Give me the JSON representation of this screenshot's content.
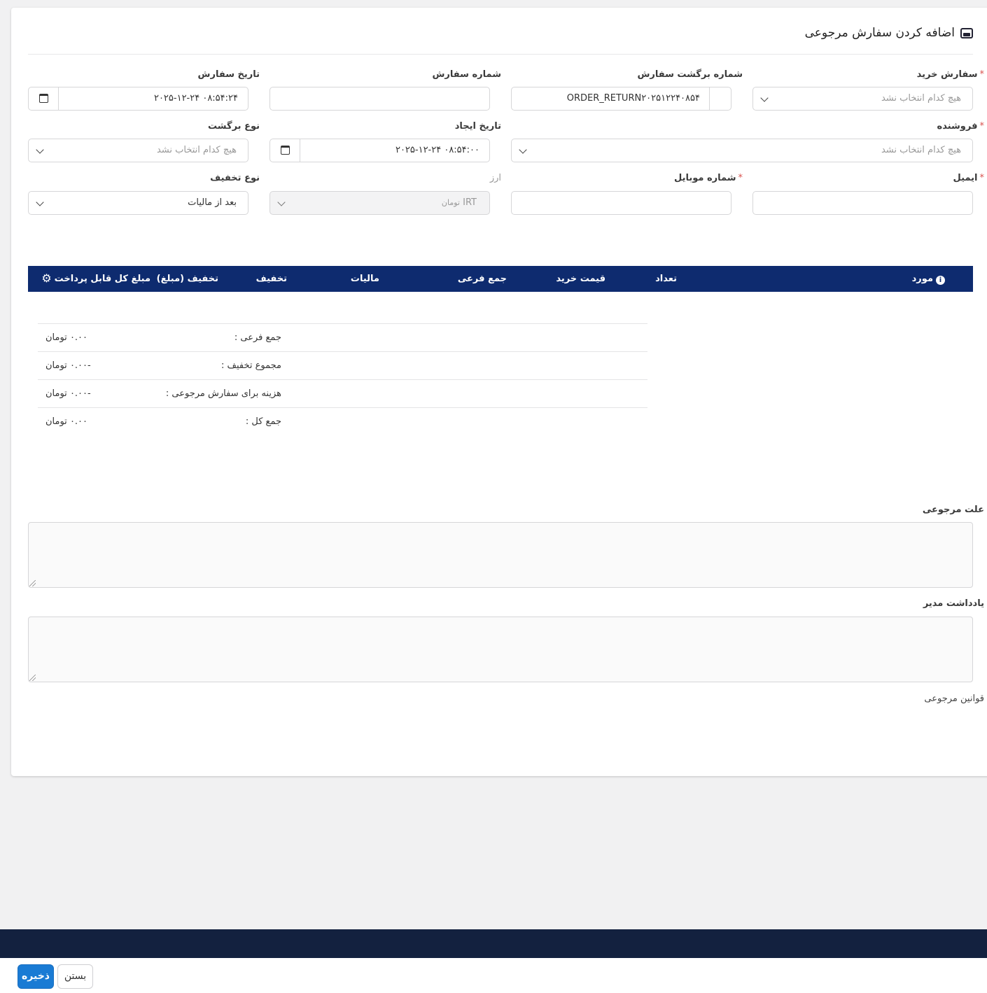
{
  "page": {
    "title": "اضافه کردن سفارش مرجوعی"
  },
  "form": {
    "purchase_order": {
      "label": "سفارش خرید",
      "required": "*",
      "placeholder": "هیچ کدام انتخاب نشد"
    },
    "return_number": {
      "label": "شماره برگشت سفارش",
      "value": "ORDER_RETURN۲۰۲۵۱۲۲۴۰۸۵۴"
    },
    "order_number": {
      "label": "شماره سفارش",
      "value": ""
    },
    "order_date": {
      "label": "تاریخ سفارش",
      "value": "۲۰۲۵-۱۲-۲۴ ۰۸:۵۴:۲۴"
    },
    "vendor": {
      "label": "فروشنده",
      "required": "*",
      "placeholder": "هیچ کدام انتخاب نشد"
    },
    "created_date": {
      "label": "تاریخ ایجاد",
      "value": "۲۰۲۵-۱۲-۲۴ ۰۸:۵۴:۰۰"
    },
    "return_type": {
      "label": "نوع برگشت",
      "placeholder": "هیچ کدام انتخاب نشد"
    },
    "email": {
      "label": "ایمیل",
      "required": "*",
      "value": ""
    },
    "mobile": {
      "label": "شماره موبایل",
      "required": "*",
      "value": ""
    },
    "currency": {
      "label": "ارز",
      "value": "IRT",
      "sub": "تومان"
    },
    "discount_type": {
      "label": "نوع تخفیف",
      "value": "بعد از مالیات"
    }
  },
  "table": {
    "columns": {
      "item": "مورد",
      "qty": "تعداد",
      "price": "قیمت خرید",
      "subtotal": "جمع فرعی",
      "tax": "مالیات",
      "discount": "تخفیف",
      "discount_amount": "تخفیف (مبلغ)",
      "total": "مبلغ کل قابل پرداخت"
    },
    "info_icon": "i",
    "settings_icon": "⚙"
  },
  "totals": [
    {
      "label": "جمع فرعی :",
      "value": "۰.۰۰ تومان"
    },
    {
      "label": "مجموع تخفیف :",
      "value": "-۰.۰۰ تومان"
    },
    {
      "label": "هزینه برای سفارش مرجوعی :",
      "value": "-۰.۰۰ تومان"
    },
    {
      "label": "جمع کل :",
      "value": "۰.۰۰ تومان"
    }
  ],
  "return_reason": {
    "label": "علت مرجوعی",
    "value": ""
  },
  "admin_note": {
    "label": "یادداشت مدیر",
    "value": ""
  },
  "return_policy": {
    "label": "قوانین مرجوعی"
  },
  "footer": {
    "save": "ذخیره",
    "close": "بستن"
  },
  "colors": {
    "table_header": "#0e2b6f",
    "primary": "#1a7bd4",
    "footer_bar": "#13213f",
    "required": "#d9534f"
  }
}
